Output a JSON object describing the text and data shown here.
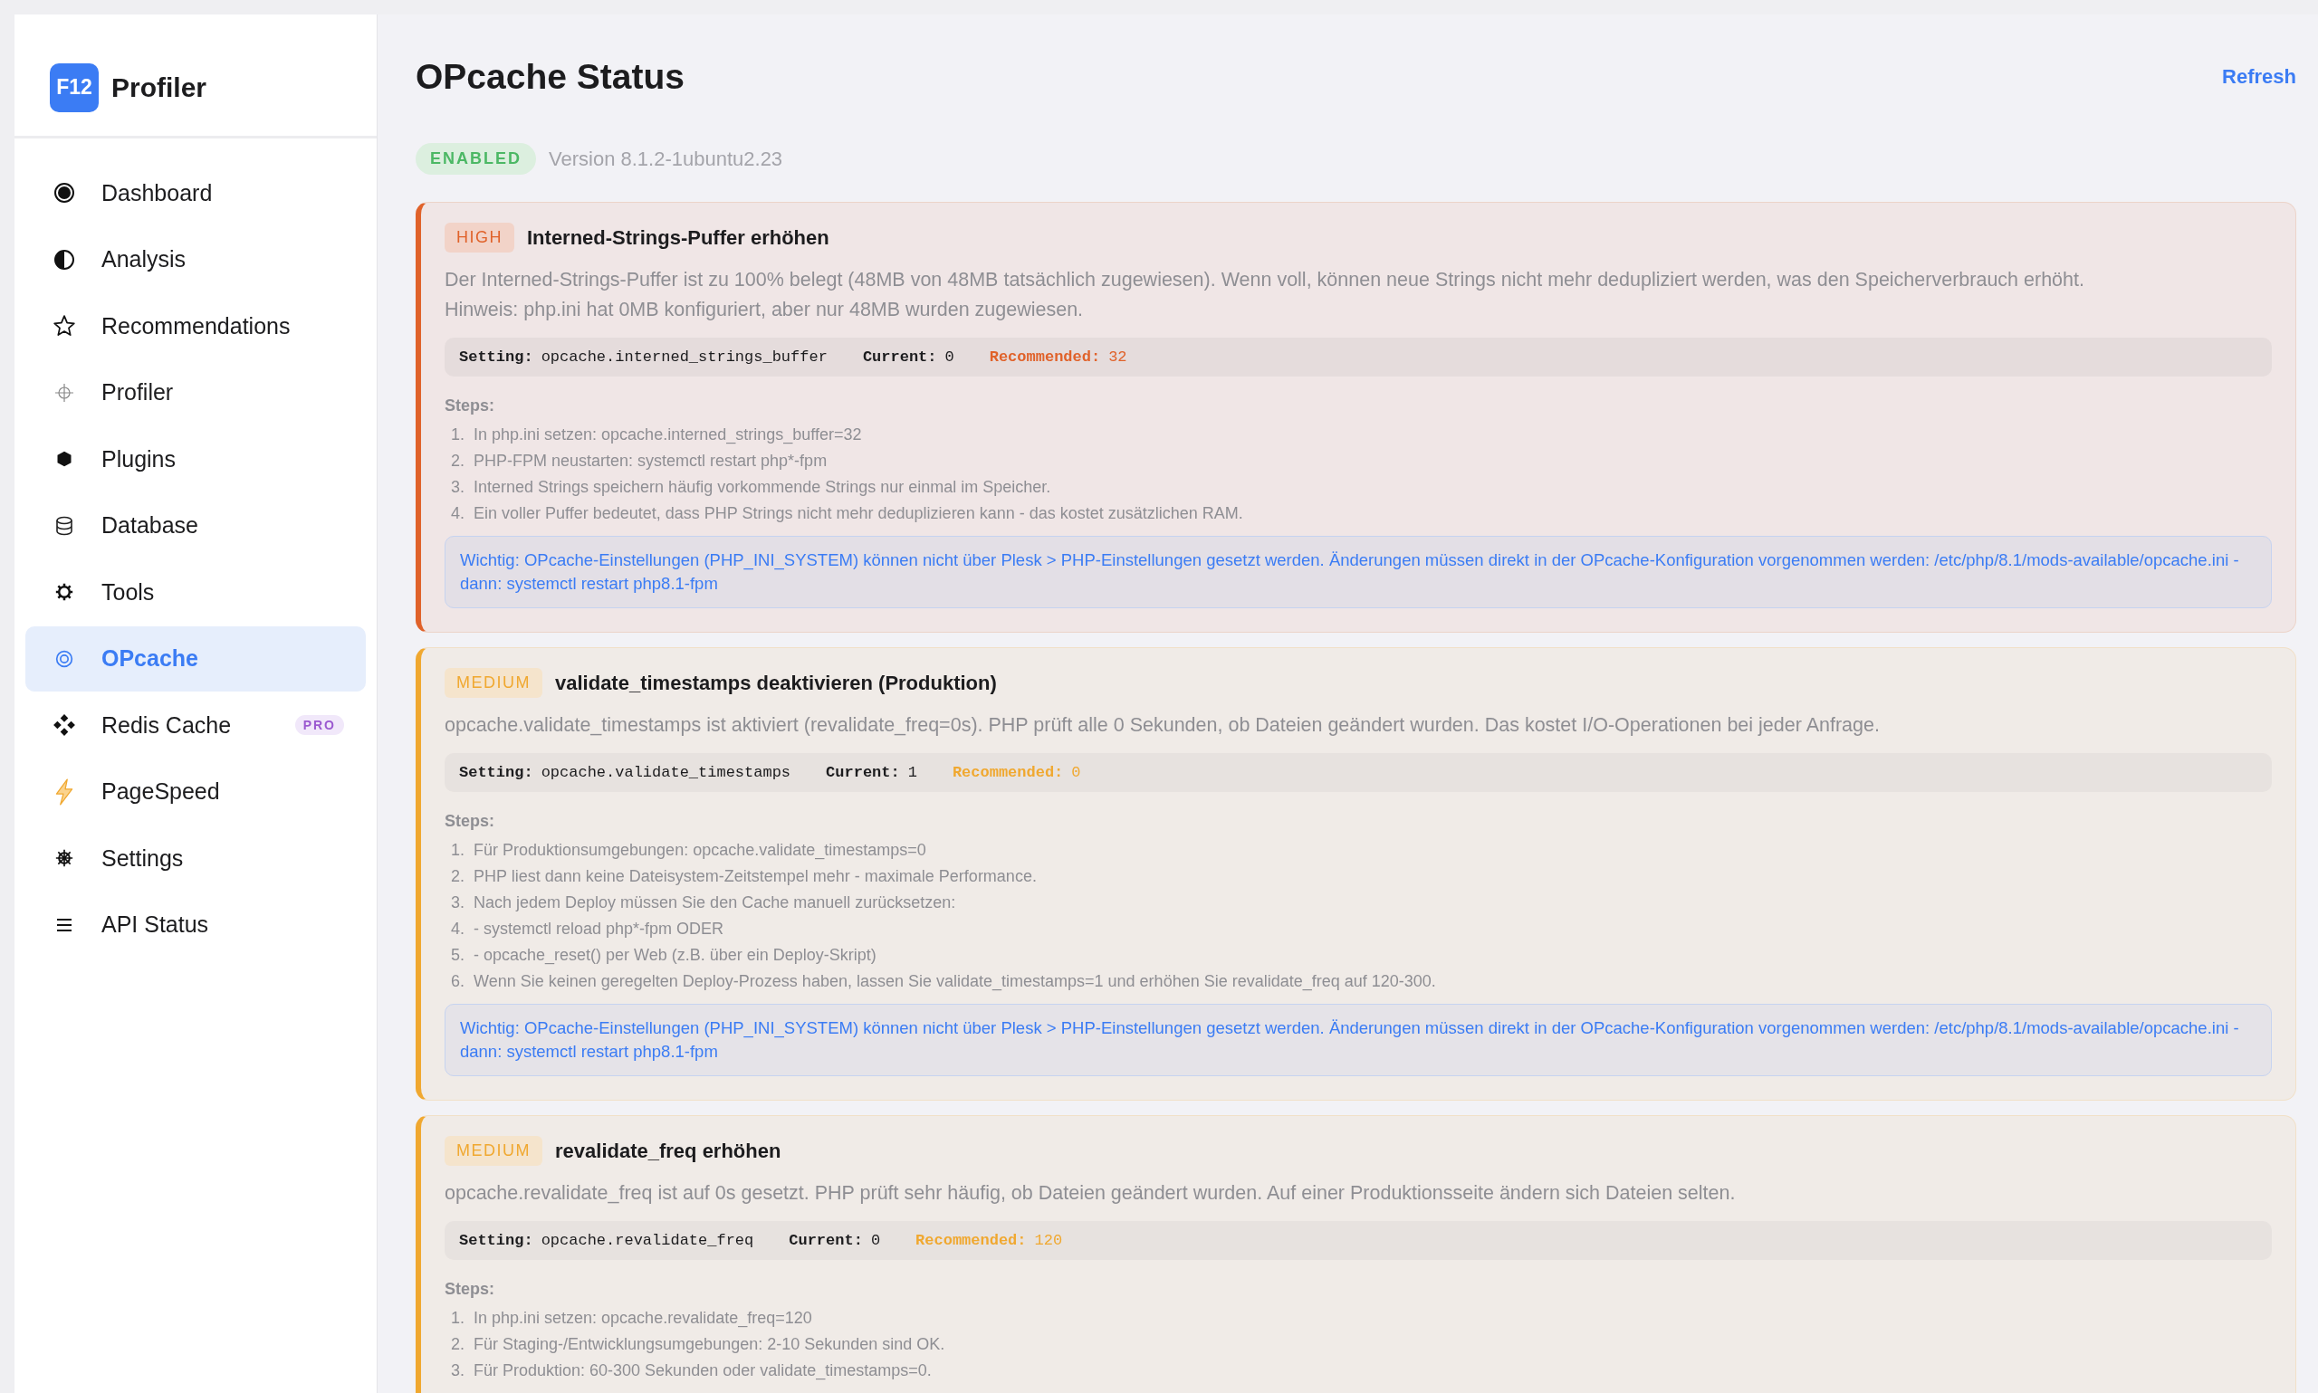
{
  "sidebar": {
    "logo": "F12",
    "app_name": "Profiler",
    "items": [
      {
        "label": "Dashboard",
        "kind": "dashboard",
        "selected": false
      },
      {
        "label": "Analysis",
        "kind": "analysis",
        "selected": false
      },
      {
        "label": "Recommendations",
        "kind": "star",
        "selected": false
      },
      {
        "label": "Profiler",
        "kind": "crosshair",
        "selected": false
      },
      {
        "label": "Plugins",
        "kind": "hexagon",
        "selected": false
      },
      {
        "label": "Database",
        "kind": "database",
        "selected": false
      },
      {
        "label": "Tools",
        "kind": "gear",
        "selected": false
      },
      {
        "label": "OPcache",
        "kind": "target",
        "selected": true
      },
      {
        "label": "Redis Cache",
        "kind": "diamonds",
        "selected": false,
        "badge": "PRO"
      },
      {
        "label": "PageSpeed",
        "kind": "bolt",
        "selected": false
      },
      {
        "label": "Settings",
        "kind": "wheel",
        "selected": false
      },
      {
        "label": "API Status",
        "kind": "lines",
        "selected": false
      }
    ]
  },
  "page": {
    "title": "OPcache Status",
    "refresh": "Refresh",
    "status": "ENABLED",
    "version": "Version 8.1.2-1ubuntu2.23"
  },
  "recommendations": [
    {
      "kind": "high",
      "badge": "HIGH",
      "title": "Interned-Strings-Puffer erhöhen",
      "description": "Der Interned-Strings-Puffer ist zu 100% belegt (48MB von 48MB tatsächlich zugewiesen). Wenn voll, können neue Strings nicht mehr dedupliziert werden, was den Speicherverbrauch erhöht.\nHinweis: php.ini hat 0MB konfiguriert, aber nur 48MB wurden zugewiesen.",
      "setting_label": "Setting:",
      "setting": "opcache.interned_strings_buffer",
      "current_label": "Current:",
      "current": "0",
      "recommended_label": "Recommended:",
      "recommended": "32",
      "steps_label": "Steps:",
      "steps": [
        {
          "number": "1.",
          "text": "In php.ini setzen: opcache.interned_strings_buffer=32"
        },
        {
          "number": "2.",
          "text": "PHP-FPM neustarten: systemctl restart php*-fpm"
        },
        {
          "number": "3.",
          "text": "Interned Strings speichern häufig vorkommende Strings nur einmal im Speicher."
        },
        {
          "number": "4.",
          "text": "Ein voller Puffer bedeutet, dass PHP Strings nicht mehr deduplizieren kann - das kostet zusätzlichen RAM."
        }
      ],
      "note": "Wichtig: OPcache-Einstellungen (PHP_INI_SYSTEM) können nicht über Plesk > PHP-Einstellungen gesetzt werden. Änderungen müssen direkt in der OPcache-Konfiguration vorgenommen werden: /etc/php/8.1/mods-available/opcache.ini - dann: systemctl restart php8.1-fpm"
    },
    {
      "kind": "medium",
      "badge": "MEDIUM",
      "title": "validate_timestamps deaktivieren (Produktion)",
      "description": "opcache.validate_timestamps ist aktiviert (revalidate_freq=0s). PHP prüft alle 0 Sekunden, ob Dateien geändert wurden. Das kostet I/O-Operationen bei jeder Anfrage.",
      "setting_label": "Setting:",
      "setting": "opcache.validate_timestamps",
      "current_label": "Current:",
      "current": "1",
      "recommended_label": "Recommended:",
      "recommended": "0",
      "steps_label": "Steps:",
      "steps": [
        {
          "number": "1.",
          "text": "Für Produktionsumgebungen: opcache.validate_timestamps=0"
        },
        {
          "number": "2.",
          "text": "PHP liest dann keine Dateisystem-Zeitstempel mehr - maximale Performance."
        },
        {
          "number": "3.",
          "text": "Nach jedem Deploy müssen Sie den Cache manuell zurücksetzen:"
        },
        {
          "number": "4.",
          "text": "- systemctl reload php*-fpm ODER"
        },
        {
          "number": "5.",
          "text": "- opcache_reset() per Web (z.B. über ein Deploy-Skript)"
        },
        {
          "number": "6.",
          "text": "Wenn Sie keinen geregelten Deploy-Prozess haben, lassen Sie validate_timestamps=1 und erhöhen Sie revalidate_freq auf 120-300."
        }
      ],
      "note": "Wichtig: OPcache-Einstellungen (PHP_INI_SYSTEM) können nicht über Plesk > PHP-Einstellungen gesetzt werden. Änderungen müssen direkt in der OPcache-Konfiguration vorgenommen werden: /etc/php/8.1/mods-available/opcache.ini - dann: systemctl restart php8.1-fpm"
    },
    {
      "kind": "medium",
      "badge": "MEDIUM",
      "title": "revalidate_freq erhöhen",
      "description": "opcache.revalidate_freq ist auf 0s gesetzt. PHP prüft sehr häufig, ob Dateien geändert wurden. Auf einer Produktionsseite ändern sich Dateien selten.",
      "setting_label": "Setting:",
      "setting": "opcache.revalidate_freq",
      "current_label": "Current:",
      "current": "0",
      "recommended_label": "Recommended:",
      "recommended": "120",
      "steps_label": "Steps:",
      "steps": [
        {
          "number": "1.",
          "text": "In php.ini setzen: opcache.revalidate_freq=120"
        },
        {
          "number": "2.",
          "text": "Für Staging-/Entwicklungsumgebungen: 2-10 Sekunden sind OK."
        },
        {
          "number": "3.",
          "text": "Für Produktion: 60-300 Sekunden oder validate_timestamps=0."
        }
      ]
    }
  ]
}
